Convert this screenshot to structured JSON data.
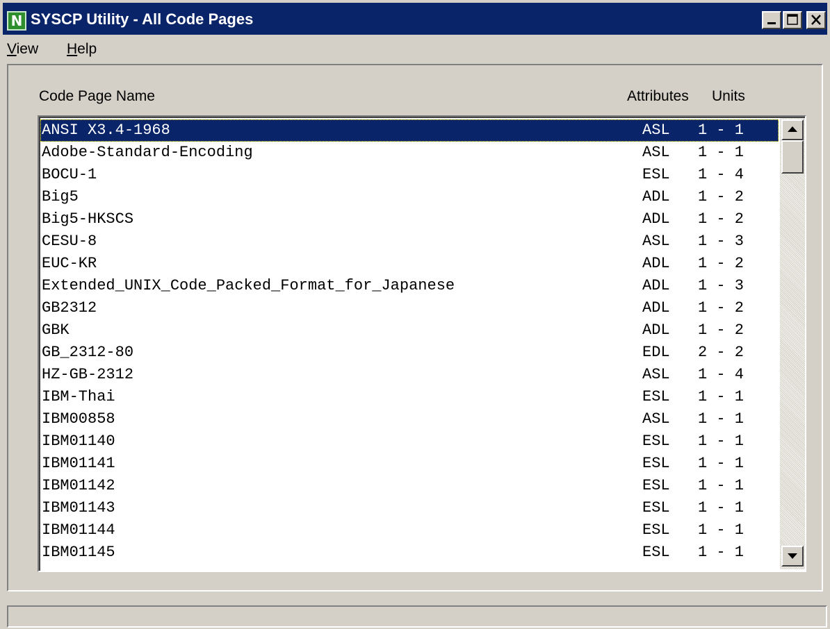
{
  "window": {
    "title": "SYSCP Utility - All Code Pages",
    "app_icon_letter": "N"
  },
  "menu": [
    {
      "label": "View",
      "mnemonic": "V",
      "rest": "iew"
    },
    {
      "label": "Help",
      "mnemonic": "H",
      "rest": "elp"
    }
  ],
  "list": {
    "headers": {
      "name": "Code Page Name",
      "attributes": "Attributes",
      "units": "Units"
    },
    "selected_index": 0,
    "rows": [
      {
        "name": "ANSI X3.4-1968",
        "attributes": "ASL",
        "units": "1 - 1"
      },
      {
        "name": "Adobe-Standard-Encoding",
        "attributes": "ASL",
        "units": "1 - 1"
      },
      {
        "name": "BOCU-1",
        "attributes": "ESL",
        "units": "1 - 4"
      },
      {
        "name": "Big5",
        "attributes": "ADL",
        "units": "1 - 2"
      },
      {
        "name": "Big5-HKSCS",
        "attributes": "ADL",
        "units": "1 - 2"
      },
      {
        "name": "CESU-8",
        "attributes": "ASL",
        "units": "1 - 3"
      },
      {
        "name": "EUC-KR",
        "attributes": "ADL",
        "units": "1 - 2"
      },
      {
        "name": "Extended_UNIX_Code_Packed_Format_for_Japanese",
        "attributes": "ADL",
        "units": "1 - 3"
      },
      {
        "name": "GB2312",
        "attributes": "ADL",
        "units": "1 - 2"
      },
      {
        "name": "GBK",
        "attributes": "ADL",
        "units": "1 - 2"
      },
      {
        "name": "GB_2312-80",
        "attributes": "EDL",
        "units": "2 - 2"
      },
      {
        "name": "HZ-GB-2312",
        "attributes": "ASL",
        "units": "1 - 4"
      },
      {
        "name": "IBM-Thai",
        "attributes": "ESL",
        "units": "1 - 1"
      },
      {
        "name": "IBM00858",
        "attributes": "ASL",
        "units": "1 - 1"
      },
      {
        "name": "IBM01140",
        "attributes": "ESL",
        "units": "1 - 1"
      },
      {
        "name": "IBM01141",
        "attributes": "ESL",
        "units": "1 - 1"
      },
      {
        "name": "IBM01142",
        "attributes": "ESL",
        "units": "1 - 1"
      },
      {
        "name": "IBM01143",
        "attributes": "ESL",
        "units": "1 - 1"
      },
      {
        "name": "IBM01144",
        "attributes": "ESL",
        "units": "1 - 1"
      },
      {
        "name": "IBM01145",
        "attributes": "ESL",
        "units": "1 - 1"
      }
    ]
  },
  "status_bar": {
    "text": ""
  },
  "colors": {
    "titlebar": "#0a246a",
    "selection": "#0a246a",
    "face": "#d4d0c8"
  }
}
